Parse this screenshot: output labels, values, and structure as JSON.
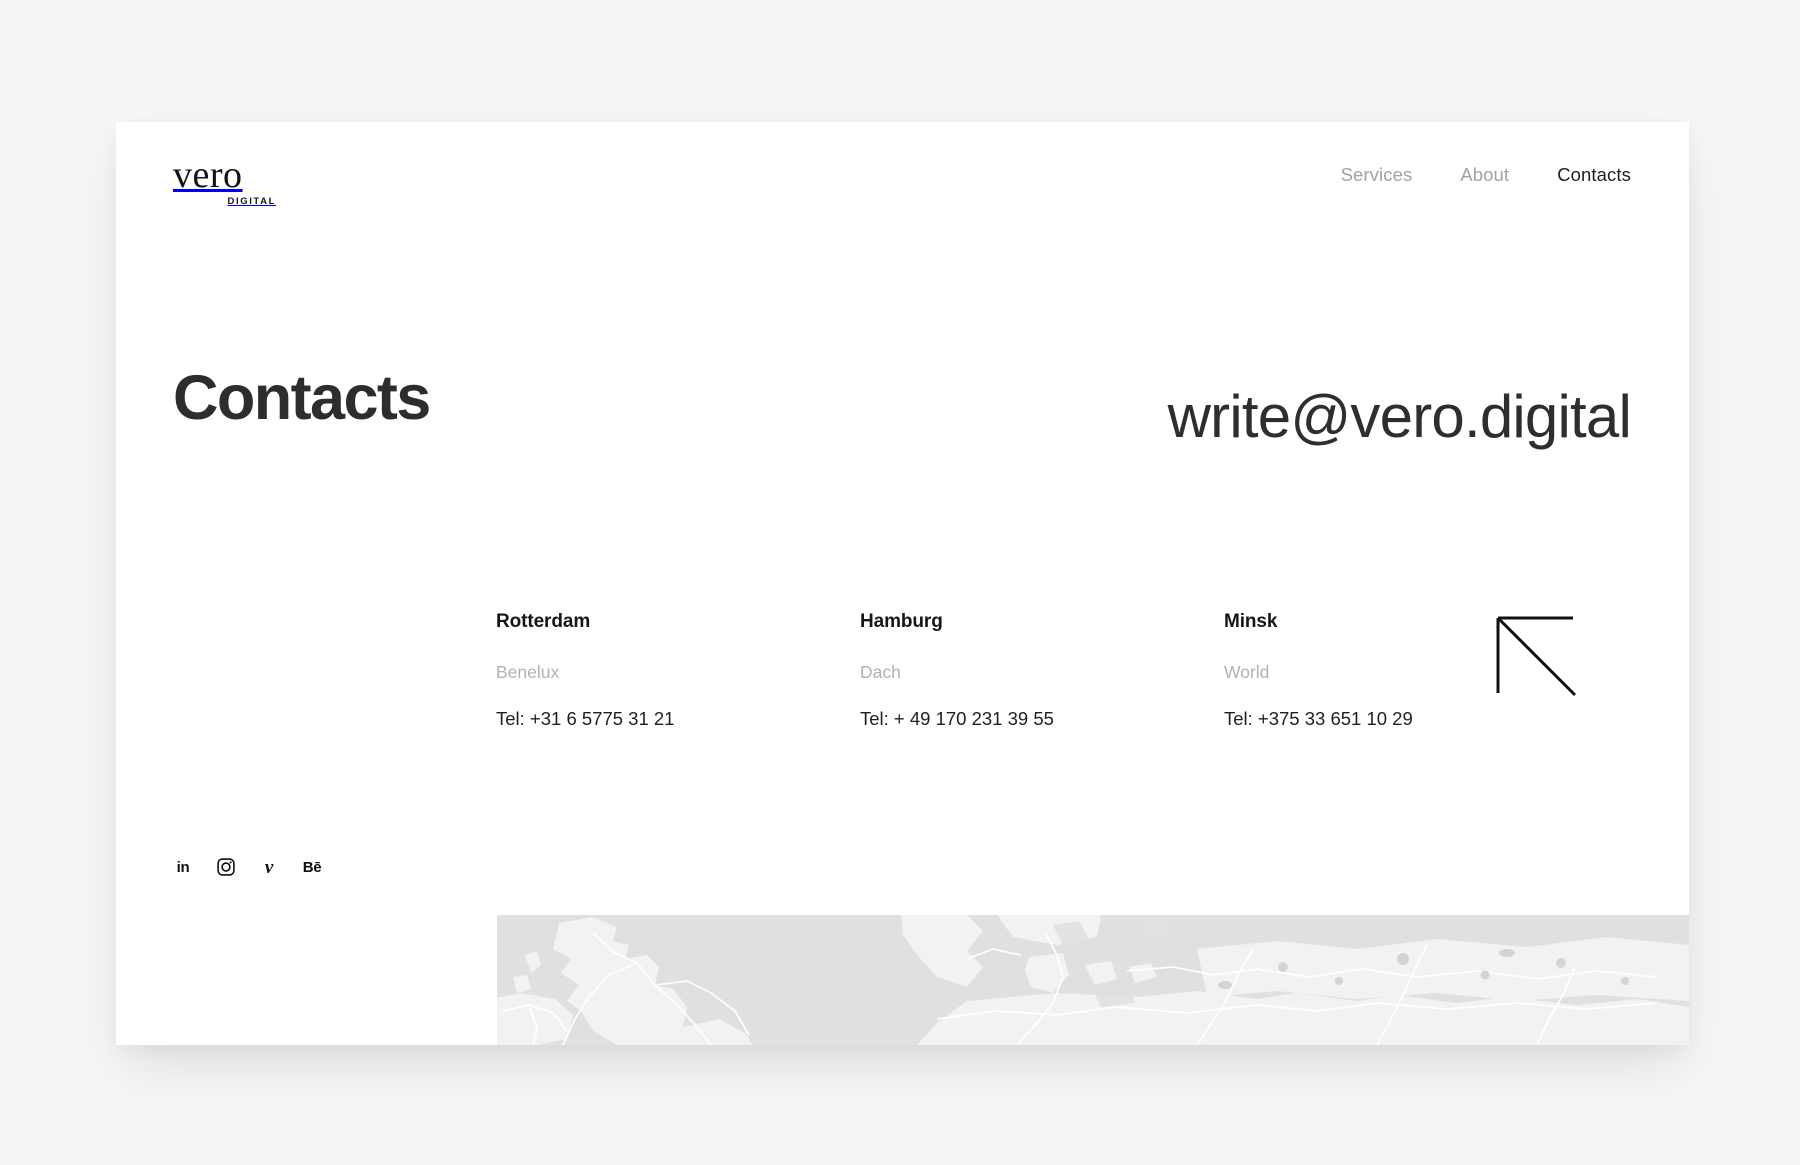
{
  "brand": {
    "name": "vero",
    "tagline": "DIGITAL"
  },
  "nav": {
    "items": [
      {
        "label": "Services",
        "active": false
      },
      {
        "label": "About",
        "active": false
      },
      {
        "label": "Contacts",
        "active": true
      }
    ]
  },
  "hero": {
    "title": "Contacts",
    "email": "write@vero.digital"
  },
  "offices": [
    {
      "city": "Rotterdam",
      "region": "Benelux",
      "phone": "Tel: +31 6 5775 31 21"
    },
    {
      "city": "Hamburg",
      "region": "Dach",
      "phone": "Tel: + 49 170 231 39 55"
    },
    {
      "city": "Minsk",
      "region": "World",
      "phone": "Tel: +375 33 651 10 29"
    }
  ],
  "decor": {
    "arrow": "arrow-up-left"
  },
  "socials": [
    {
      "name": "linkedin",
      "label": "in"
    },
    {
      "name": "instagram",
      "label": ""
    },
    {
      "name": "vimeo",
      "label": "v"
    },
    {
      "name": "behance",
      "label": "Bē"
    }
  ],
  "map": {
    "caption": "Europe map band",
    "background_color": "#e0e0e0",
    "land_color": "#f2f2f2",
    "road_color": "#ffffff"
  },
  "colors": {
    "page_background": "#f5f5f5",
    "card_background": "#ffffff",
    "text_primary": "#1e1e1e",
    "text_muted": "#b2b2b2",
    "nav_inactive": "#a2a2a2"
  }
}
